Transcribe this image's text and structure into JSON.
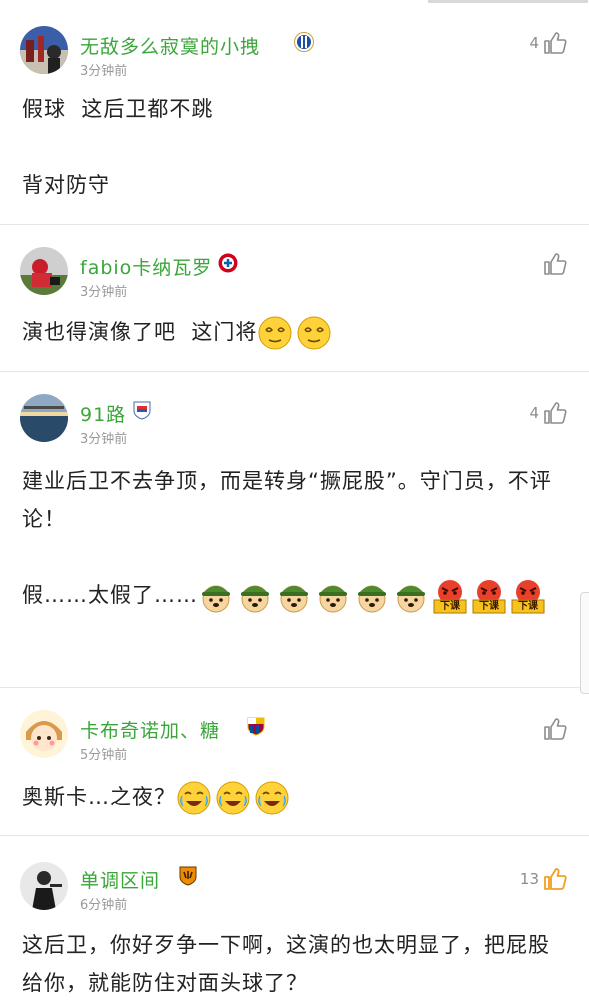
{
  "comments": [
    {
      "username": "无敌多么寂寞的小拽",
      "time": "3分钟前",
      "likes": "4",
      "liked": false,
      "badge_icon": "espanyol-badge-icon",
      "paragraphs": [
        "假球  这后卫都不跳",
        "",
        "背对防守"
      ]
    },
    {
      "username": "fabio卡纳瓦罗",
      "time": "3分钟前",
      "likes": "",
      "liked": false,
      "badge_icon": "bayern-badge-icon",
      "paragraphs": [
        "演也得演像了吧  这门将"
      ],
      "emojis": [
        "dizzy-face-emoji",
        "dizzy-face-emoji"
      ]
    },
    {
      "username": "91路",
      "time": "3分钟前",
      "likes": "4",
      "liked": false,
      "badge_icon": "club-shield-badge-icon",
      "paragraphs": [
        "建业后卫不去争顶，而是转身“撅屁股”。守门员，不评论！",
        "",
        "假……太假了……"
      ],
      "emojis": [
        "soldier-doge-emoji",
        "soldier-doge-emoji",
        "soldier-doge-emoji",
        "soldier-doge-emoji",
        "soldier-doge-emoji",
        "soldier-doge-emoji",
        "angry-xiake-emoji",
        "angry-xiake-emoji",
        "angry-xiake-emoji"
      ],
      "emoji_caption": "下课"
    },
    {
      "username": "卡布奇诺加、糖",
      "time": "5分钟前",
      "likes": "",
      "liked": false,
      "badge_icon": "barcelona-badge-icon",
      "paragraphs": [
        "奥斯卡…之夜？"
      ],
      "emojis": [
        "crying-laugh-emoji",
        "crying-laugh-emoji",
        "crying-laugh-emoji"
      ]
    },
    {
      "username": "单调区间",
      "time": "6分钟前",
      "likes": "13",
      "liked": true,
      "badge_icon": "tigers-badge-icon",
      "paragraphs": [
        "这后卫，你好歹争一下啊，这演的也太明显了，把屁股给你，就能防住对面头球了？"
      ]
    }
  ],
  "colors": {
    "username": "#3aa63a",
    "time": "#9a9a9a",
    "like_active": "#f0a020",
    "like_inactive": "#8c8c8c",
    "divider": "#e6e6e6"
  }
}
